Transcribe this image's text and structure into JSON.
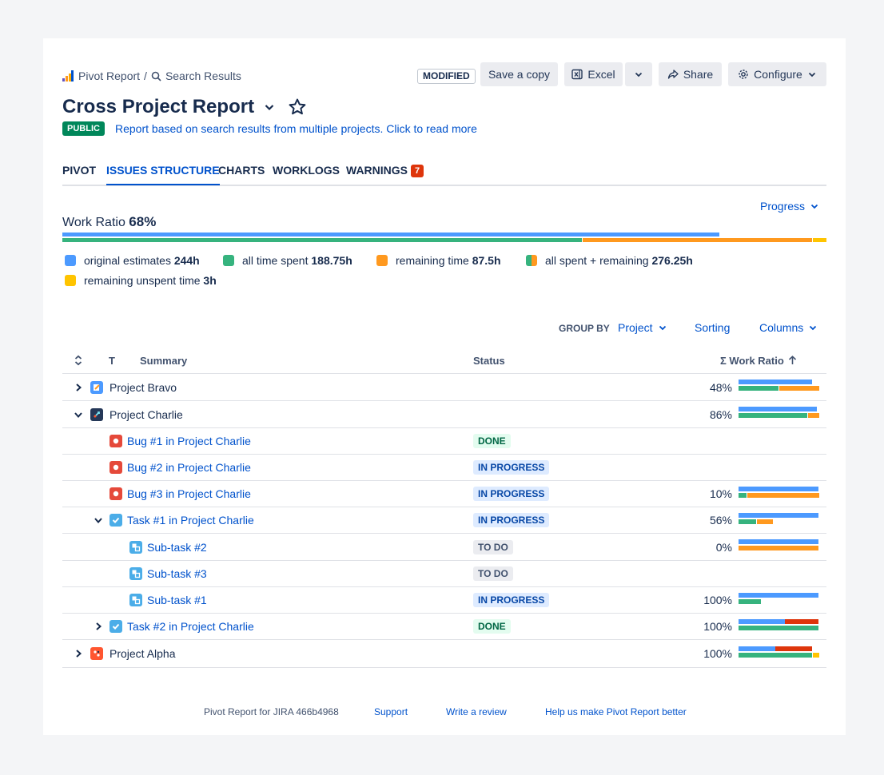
{
  "breadcrumb": {
    "root": "Pivot Report",
    "separator": "/",
    "current": "Search Results"
  },
  "toolbar": {
    "modified": "MODIFIED",
    "save_copy": "Save a copy",
    "excel": "Excel",
    "share": "Share",
    "configure": "Configure"
  },
  "report": {
    "title": "Cross Project Report",
    "visibility": "PUBLIC",
    "description": "Report based on search results from multiple projects. Click to read more"
  },
  "tabs": [
    {
      "label": "PIVOT",
      "active": false
    },
    {
      "label": "ISSUES STRUCTURE",
      "active": true
    },
    {
      "label": "CHARTS",
      "active": false
    },
    {
      "label": "WORKLOGS",
      "active": false
    },
    {
      "label": "WARNINGS",
      "active": false,
      "badge": "7"
    }
  ],
  "progress_dropdown": "Progress",
  "work_ratio": {
    "label": "Work Ratio",
    "value": "68%",
    "original_fraction": 0.86,
    "spent_fraction": 0.68,
    "remaining_fraction": 0.3,
    "unspent_fraction": 0.02
  },
  "legend": [
    {
      "label": "original estimates",
      "value": "244h",
      "color": "#4c9aff"
    },
    {
      "label": "all time spent",
      "value": "188.75h",
      "color": "#36b37e"
    },
    {
      "label": "remaining time",
      "value": "87.5h",
      "color": "#ff991f"
    },
    {
      "label": "all spent + remaining",
      "value": "276.25h",
      "color": "split"
    },
    {
      "label": "remaining unspent time",
      "value": "3h",
      "color": "#ffc400"
    }
  ],
  "controls": {
    "group_by_label": "GROUP BY",
    "group_by_value": "Project",
    "sorting": "Sorting",
    "columns": "Columns"
  },
  "columns": {
    "type": "T",
    "summary": "Summary",
    "status": "Status",
    "work_ratio": "Σ Work Ratio"
  },
  "rows": [
    {
      "kind": "project",
      "name": "Project Bravo",
      "icon": "bravo-project-icon",
      "expanded": false,
      "ratio": "48%",
      "bars": {
        "orig": 0.92,
        "spent": 0.5,
        "remaining": 0.5,
        "unspent": 0
      }
    },
    {
      "kind": "project",
      "name": "Project Charlie",
      "icon": "charlie-project-icon",
      "expanded": true,
      "ratio": "86%",
      "bars": {
        "orig": 0.98,
        "spent": 0.86,
        "remaining": 0.14,
        "unspent": 0
      }
    },
    {
      "kind": "bug",
      "name": "Bug #1 in Project Charlie",
      "status": "DONE",
      "ratio": ""
    },
    {
      "kind": "bug",
      "name": "Bug #2 in Project Charlie",
      "status": "IN PROGRESS",
      "ratio": ""
    },
    {
      "kind": "bug",
      "name": "Bug #3 in Project Charlie",
      "status": "IN PROGRESS",
      "ratio": "10%",
      "bars": {
        "orig": 1.0,
        "spent": 0.1,
        "remaining": 0.9,
        "unspent": 0
      }
    },
    {
      "kind": "task",
      "name": "Task #1 in Project Charlie",
      "status": "IN PROGRESS",
      "expanded": true,
      "ratio": "56%",
      "bars": {
        "orig": 1.0,
        "spent": 0.22,
        "remaining": 0.2,
        "unspent": 0
      }
    },
    {
      "kind": "subtask",
      "name": "Sub-task #2",
      "status": "TO DO",
      "ratio": "0%",
      "bars": {
        "orig": 1.0,
        "spent": 0,
        "remaining": 1.0,
        "unspent": 0
      }
    },
    {
      "kind": "subtask",
      "name": "Sub-task #3",
      "status": "TO DO",
      "ratio": ""
    },
    {
      "kind": "subtask",
      "name": "Sub-task #1",
      "status": "IN PROGRESS",
      "ratio": "100%",
      "bars": {
        "orig": 1.0,
        "spent": 0.28,
        "remaining": 0,
        "unspent": 0
      }
    },
    {
      "kind": "task",
      "name": "Task #2 in Project Charlie",
      "status": "DONE",
      "expanded": false,
      "ratio": "100%",
      "bars": {
        "orig": 0.58,
        "spent": 1.0,
        "remaining": 0,
        "unspent": 0,
        "over": 0.42
      }
    },
    {
      "kind": "project",
      "name": "Project Alpha",
      "icon": "alpha-project-icon",
      "expanded": false,
      "ratio": "100%",
      "bars": {
        "orig": 0.46,
        "spent": 0.92,
        "remaining": 0,
        "unspent": 0.08,
        "over": 0.46
      }
    }
  ],
  "footer": {
    "product": "Pivot Report for JIRA 466b4968",
    "support": "Support",
    "review": "Write a review",
    "help": "Help us make Pivot Report better"
  }
}
